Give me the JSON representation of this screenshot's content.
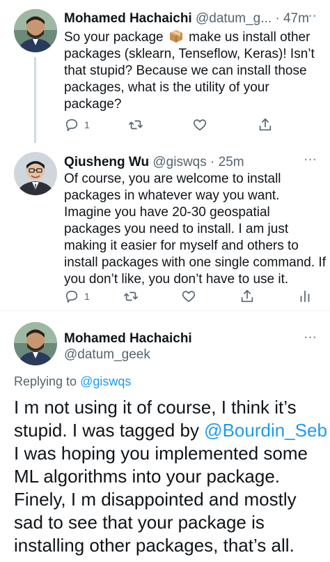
{
  "reply1": {
    "name": "Mohamed Hachaichi",
    "handle_time": "@datum_g... · 47m",
    "more": "···",
    "text_lines": [
      [
        "So your package ",
        " make us install other"
      ],
      "packages (sklearn, Tenseflow, Keras)! Isn’t",
      "that stupid? Because we can install those",
      "packages, what is the utility of your",
      "package?"
    ],
    "emoji": "package-emoji",
    "reply_count": "1"
  },
  "reply2": {
    "name": "Qiusheng Wu",
    "handle_time": "@giswqs · 25m",
    "more": "···",
    "text_lines": [
      "Of course, you are welcome to install",
      "packages in whatever way you want.",
      "Imagine you have 20-30 geospatial",
      "packages you need to install. I am just",
      "making it easier for myself and others to",
      "install packages with one single command. If",
      "you don’t like, you don’t have to use it."
    ],
    "reply_count": "1"
  },
  "main": {
    "name": "Mohamed Hachaichi",
    "handle": "@datum_geek",
    "more": "···",
    "replying_prefix": "Replying to ",
    "replying_handle": "@giswqs",
    "text_lines": [
      "I m not using it of course, I think it’s",
      [
        "stupid. I was tagged by ",
        "@Bourdin_Seb"
      ],
      "I was hoping you implemented some",
      "ML algorithms into your package.",
      "Finely, I m disappointed and mostly",
      "sad to see that your package is",
      "installing other packages, that’s all."
    ]
  },
  "colors": {
    "accent": "#1d9bf0",
    "secondary_text": "#536471",
    "primary_text": "#0f1419",
    "thread_line": "#cfd9de"
  },
  "icons": [
    "reply-icon",
    "retweet-icon",
    "like-icon",
    "share-icon",
    "analytics-icon",
    "more-icon"
  ]
}
